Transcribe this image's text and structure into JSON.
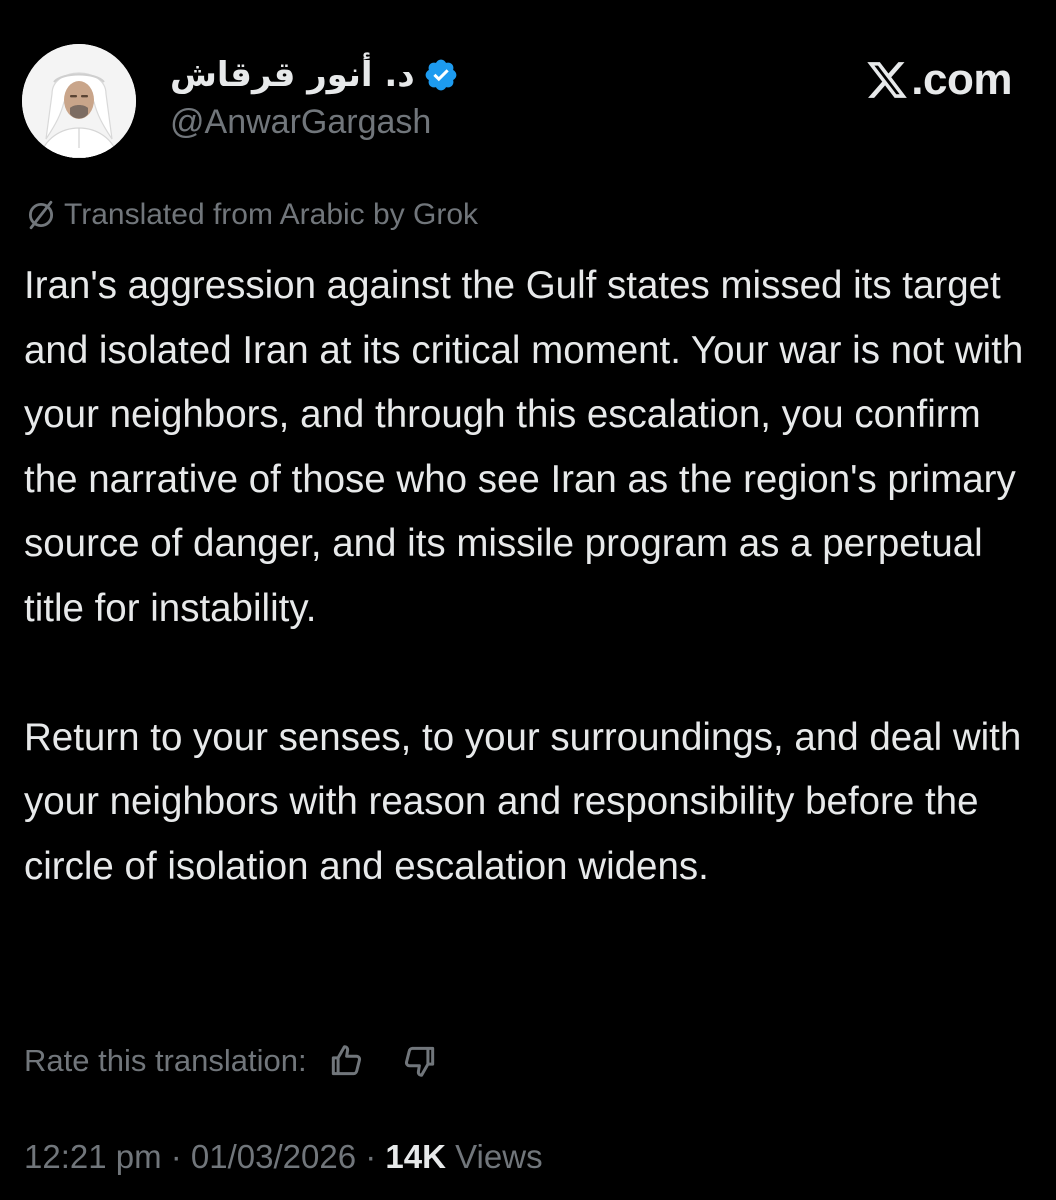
{
  "author": {
    "display_name": "د. أنور قرقاش",
    "handle": "@AnwarGargash",
    "verified_icon": "verified-badge-icon",
    "avatar_icon": "avatar-portrait"
  },
  "brand": {
    "logo_icon": "x-logo-icon",
    "text": ".com"
  },
  "translation": {
    "icon": "grok-icon",
    "note": "Translated from Arabic by Grok"
  },
  "tweet": {
    "paragraphs": [
      "Iran's aggression against the Gulf states missed its target and isolated Iran at its critical moment. Your war is not with your neighbors, and through this escalation, you confirm the narrative of those who see Iran as the region's primary source of danger, and its missile program as a perpetual title for instability.",
      "Return to your senses, to your surroundings, and deal with your neighbors with reason and responsibility before the circle of isolation and escalation widens."
    ]
  },
  "rate_translation": {
    "label": "Rate this translation:",
    "up_icon": "thumbs-up-icon",
    "down_icon": "thumbs-down-icon"
  },
  "meta": {
    "time": "12:21 pm",
    "separator": " · ",
    "date": "01/03/2026",
    "views_count": "14K",
    "views_label": " Views"
  },
  "colors": {
    "background": "#000000",
    "text": "#e7e9ea",
    "secondary_text": "#71767b",
    "verified_blue": "#1d9bf0"
  }
}
